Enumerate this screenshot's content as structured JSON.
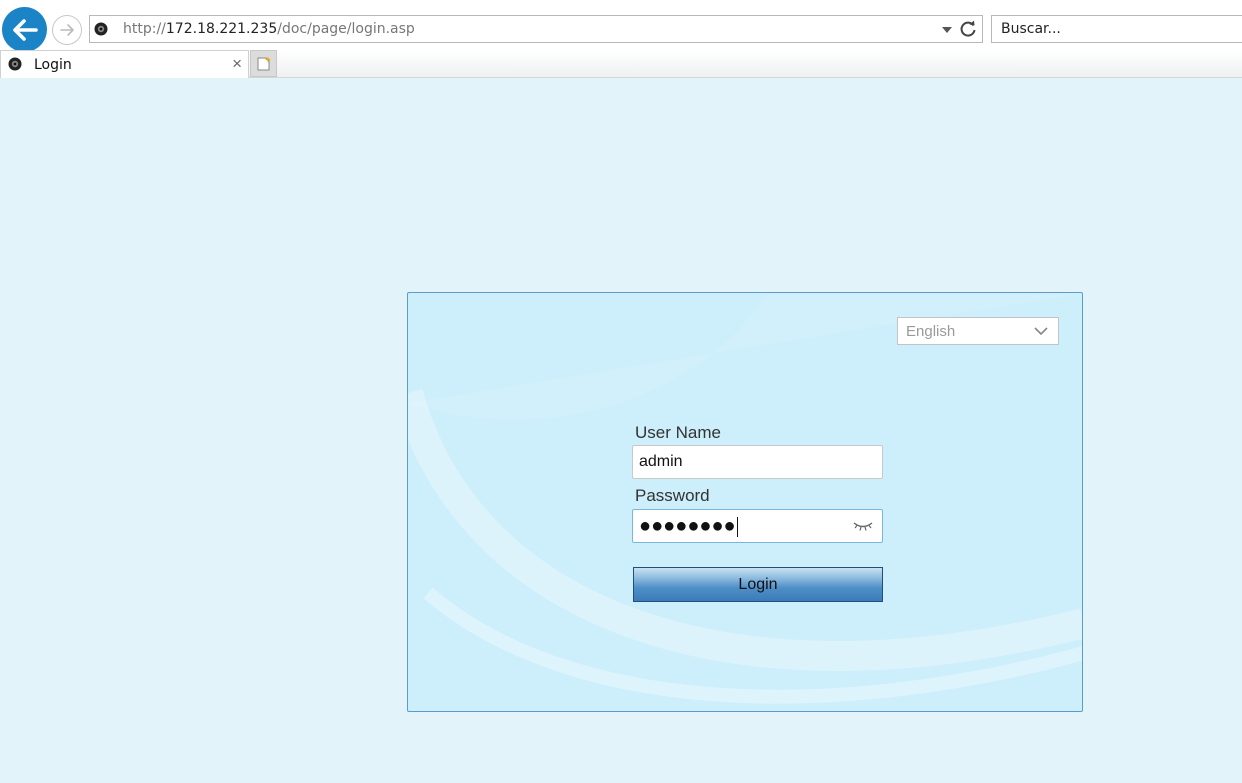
{
  "browser": {
    "address": {
      "prefix": "http://",
      "host": "172.18.221.235",
      "path": "/doc/page/login.asp"
    },
    "search_placeholder": "Buscar...",
    "tab": {
      "title": "Login"
    },
    "tab_close": "×"
  },
  "login": {
    "language": "English",
    "username_label": "User Name",
    "username_value": "admin",
    "password_label": "Password",
    "password_mask": "●●●●●●●●",
    "login_button": "Login"
  },
  "colors": {
    "page_bg": "#e2f3fa",
    "panel_bg": "#cdeefb",
    "panel_border": "#5d9cc8",
    "back_button": "#1a84c7",
    "login_button": "#3a7cb8"
  }
}
